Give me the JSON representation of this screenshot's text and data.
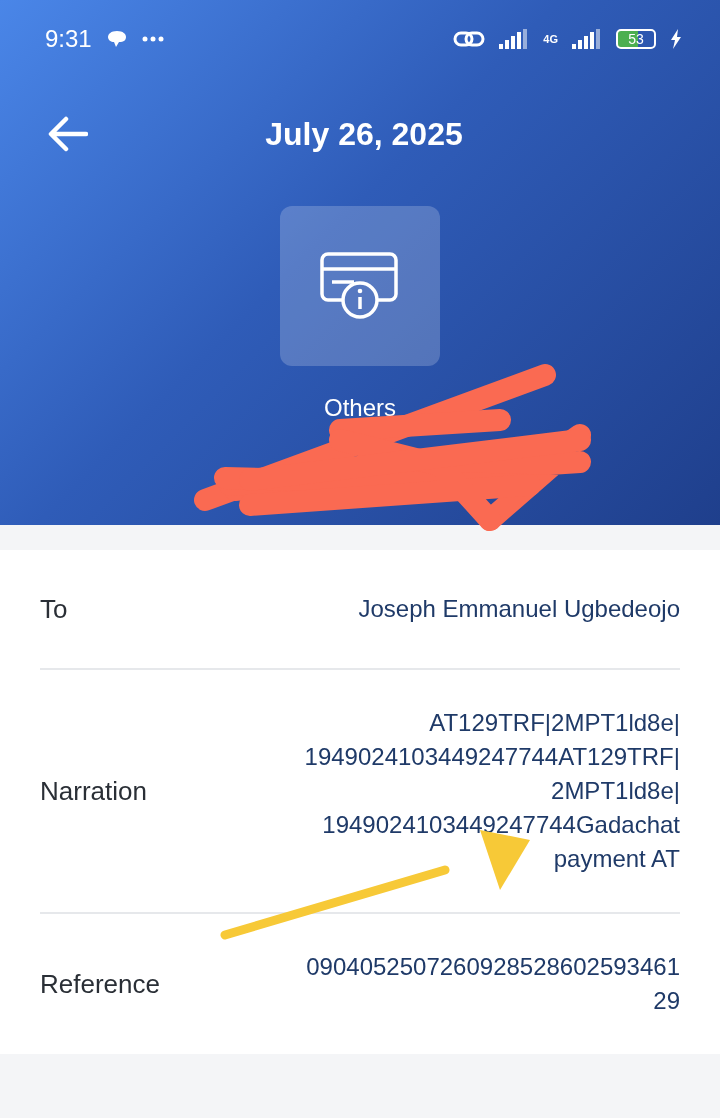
{
  "status_bar": {
    "time": "9:31",
    "network": "4G",
    "battery": "53"
  },
  "header": {
    "title": "July 26, 2025",
    "category": "Others"
  },
  "details": [
    {
      "label": "To",
      "lines": [
        "Joseph Emmanuel Ugbedeojo"
      ]
    },
    {
      "label": "Narration",
      "lines": [
        "AT129TRF|2MPT1ld8e|",
        "1949024103449247744AT129TRF|",
        "2MPT1ld8e|",
        "1949024103449247744Gadachat",
        "payment AT"
      ]
    },
    {
      "label": "Reference",
      "lines": [
        "0904052507260928528602593461",
        "29"
      ]
    }
  ]
}
